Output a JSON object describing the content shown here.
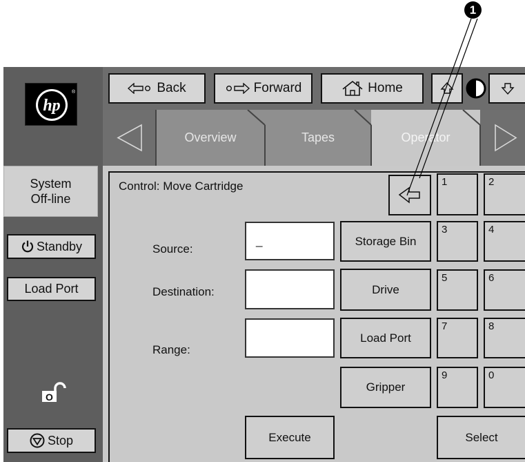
{
  "callout": {
    "number": "1"
  },
  "left_panel": {
    "logo_text": "hp",
    "status_line1": "System",
    "status_line2": "Off-line",
    "standby_label": "Standby",
    "load_port_label": "Load Port",
    "lock_label": "O",
    "stop_label": "Stop"
  },
  "toolbar": {
    "back_label": "Back",
    "forward_label": "Forward",
    "home_label": "Home"
  },
  "tabs": [
    {
      "label": "Overview"
    },
    {
      "label": "Tapes"
    },
    {
      "label": "Operator",
      "active": true
    }
  ],
  "main": {
    "title": "Control: Move Cartridge",
    "source_label": "Source:",
    "source_value": "_",
    "destination_label": "Destination:",
    "destination_value": "",
    "range_label": "Range:",
    "range_value": "",
    "storage_bin_label": "Storage Bin",
    "drive_label": "Drive",
    "load_port_label": "Load Port",
    "gripper_label": "Gripper",
    "execute_label": "Execute",
    "select_label": "Select"
  },
  "keypad": [
    "1",
    "2",
    "3",
    "4",
    "5",
    "6",
    "7",
    "8",
    "9",
    "0"
  ],
  "colors": {
    "rail": "#5e5e5e",
    "panel": "#c9c9c9",
    "tab_inactive": "#8f8f8f",
    "tab_active": "#c8c8c8"
  },
  "icons": {
    "back": "arrow-left-icon",
    "forward": "arrow-right-icon",
    "home": "home-icon",
    "up": "arrow-up-icon",
    "contrast": "contrast-icon",
    "down": "arrow-down-icon",
    "power": "power-icon",
    "lock": "unlocked-padlock-icon",
    "stop": "stop-icon",
    "backspace": "backspace-arrow-icon"
  }
}
